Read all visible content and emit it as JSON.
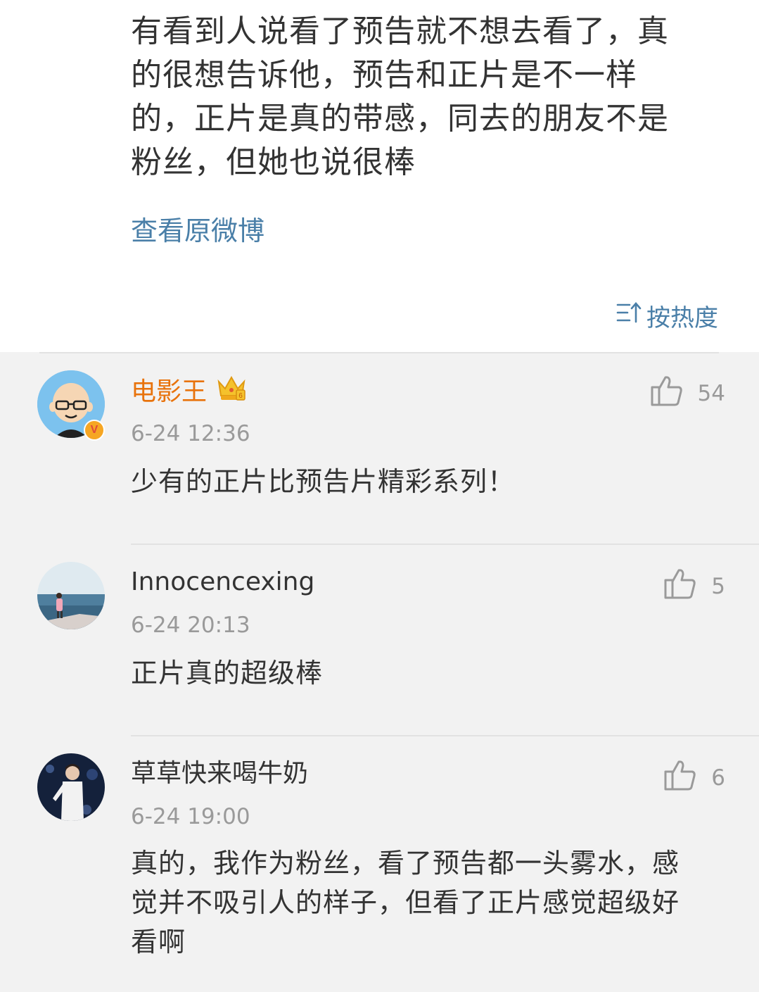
{
  "post": {
    "text_lines": [
      "有看到人说看了预告就不想去看了，真",
      "的很想告诉他，预告和正片是不一样",
      "的，正片是真的带感，同去的朋友不是",
      "粉丝，但她也说很棒"
    ],
    "view_original": "查看原微博"
  },
  "sort": {
    "label": "按热度",
    "icon": "sort-icon"
  },
  "colors": {
    "link": "#4a7fa8",
    "vip_name": "#e8730c",
    "muted": "#9a9a9a"
  },
  "comments": [
    {
      "name": "电影王",
      "time": "6-24 12:36",
      "likes": "54",
      "text_lines": [
        "少有的正片比预告片精彩系列！"
      ],
      "avatar": "cartoon-bald-man-avatar",
      "badge": "crown-vip-icon",
      "verified": "verified-v-badge"
    },
    {
      "name": "Innocencexing",
      "time": "6-24 20:13",
      "likes": "5",
      "text_lines": [
        "正片真的超级棒"
      ],
      "avatar": "seaside-photo-avatar"
    },
    {
      "name": "草草快来喝牛奶",
      "time": "6-24 19:00",
      "likes": "6",
      "text_lines": [
        "真的，我作为粉丝，看了预告都一头雾水，感",
        "觉并不吸引人的样子，但看了正片感觉超级好",
        "看啊"
      ],
      "avatar": "stage-performer-avatar"
    }
  ]
}
